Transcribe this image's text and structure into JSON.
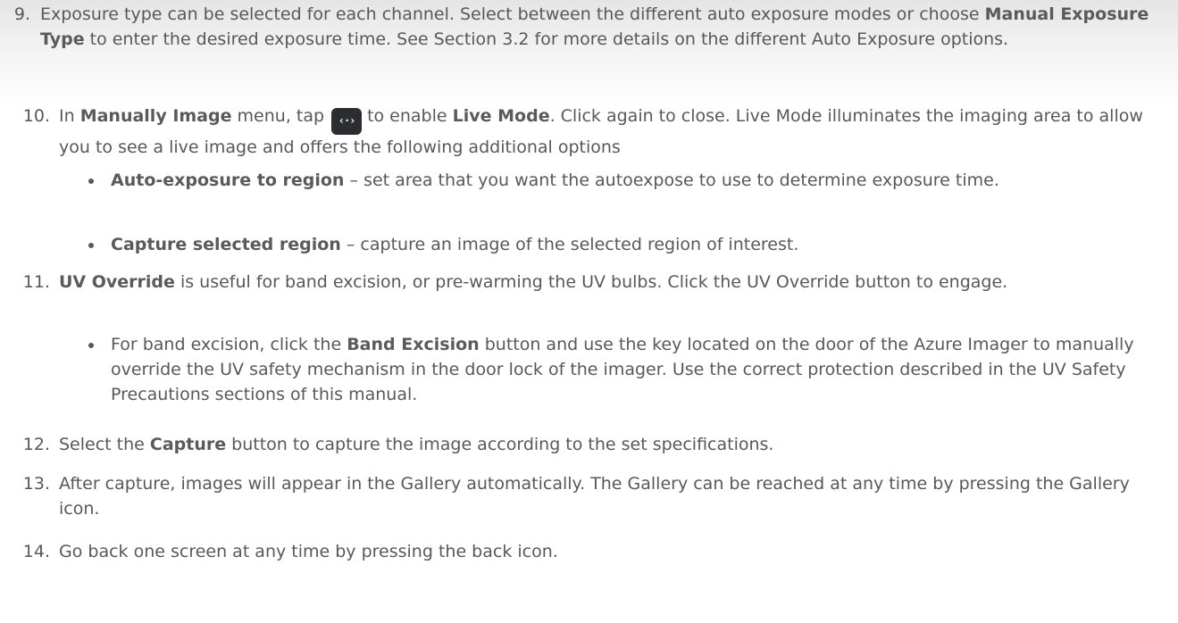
{
  "steps": {
    "s9": {
      "num": "9.",
      "a": "Exposure type can be selected for each channel. Select between the different auto exposure modes or choose ",
      "b": "Manual Exposure Type",
      "c": " to enter the desired exposure time. See Section 3.2 for more details on the different Auto Exposure options."
    },
    "s10": {
      "num": "10.",
      "a": "In ",
      "b": "Manually Image",
      "c": " menu, tap",
      "d": "to enable ",
      "e": "Live Mode",
      "f": ". Click again to close. Live Mode illuminates the imaging area to allow you to see a live image and offers the following additional options",
      "icon_glyph": "‹·›",
      "icon_name": "live-mode-icon",
      "bullets": [
        {
          "bold": "Auto-exposure to region",
          "text": " – set area that you want the autoexpose to use to determine exposure time."
        },
        {
          "bold": "Capture selected region",
          "text": " – capture an image of the selected region of interest."
        }
      ]
    },
    "s11": {
      "num": "11.",
      "b": "UV Override",
      "c": " is useful for band excision, or pre-warming the UV bulbs. Click the UV Override button to engage.",
      "bullet": {
        "a": "For band excision, click the ",
        "b": "Band Excision",
        "c": " button and use the key located on the door of the Azure Imager to manually override the UV safety mechanism in the door lock of the imager. Use the correct protection described in the UV Safety Precautions sections of this manual."
      }
    },
    "s12": {
      "num": "12.",
      "a": "Select the ",
      "b": "Capture",
      "c": " button to capture the image according to the set specifications."
    },
    "s13": {
      "num": "13.",
      "a": "After capture, images will appear in the Gallery automatically. The Gallery can be reached at any time by pressing the Gallery icon."
    },
    "s14": {
      "num": "14.",
      "a": "Go back one screen at any time by pressing the back icon."
    }
  }
}
